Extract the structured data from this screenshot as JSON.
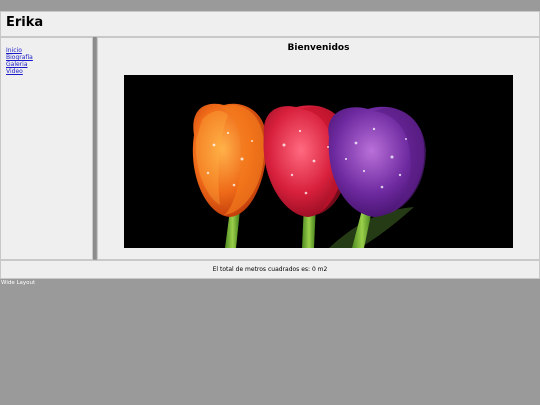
{
  "header": {
    "title": "Erika"
  },
  "sidebar": {
    "items": [
      {
        "label": "Inicio"
      },
      {
        "label": "Biografía"
      },
      {
        "label": "Galeria"
      },
      {
        "label": "Video"
      }
    ]
  },
  "main": {
    "heading": "Bienvenidos",
    "image": {
      "subject": "three tulips with water droplets (orange, red, purple) on black background"
    }
  },
  "footer": {
    "text": "El total de metros cuadrados es: 0 m2"
  },
  "layout_label": "Wide Layout",
  "colors": {
    "page_background": "#9a9a9a",
    "panel_background": "#efefef",
    "link": "#1a1ac8"
  }
}
